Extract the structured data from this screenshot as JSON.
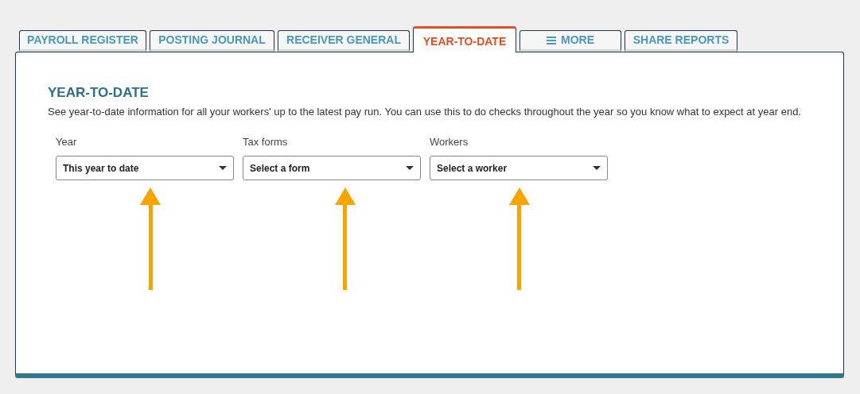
{
  "tabs": [
    {
      "label": "PAYROLL REGISTER",
      "kind": "plain",
      "selected": false
    },
    {
      "label": "POSTING JOURNAL",
      "kind": "plain",
      "selected": false
    },
    {
      "label": "RECEIVER GENERAL",
      "kind": "plain",
      "selected": false
    },
    {
      "label": "YEAR-TO-DATE",
      "kind": "plain",
      "selected": true
    },
    {
      "label": "MORE",
      "kind": "menu",
      "selected": false
    },
    {
      "label": "SHARE REPORTS",
      "kind": "plain",
      "selected": false
    }
  ],
  "panel": {
    "title": "YEAR-TO-DATE",
    "description": "See year-to-date information for all your workers' up to the latest pay run. You can use this to do checks throughout the year so you know what to expect at year end.",
    "filters": [
      {
        "label": "Year",
        "value": "This year to date"
      },
      {
        "label": "Tax forms",
        "value": "Select a form"
      },
      {
        "label": "Workers",
        "value": "Select a worker"
      }
    ]
  }
}
